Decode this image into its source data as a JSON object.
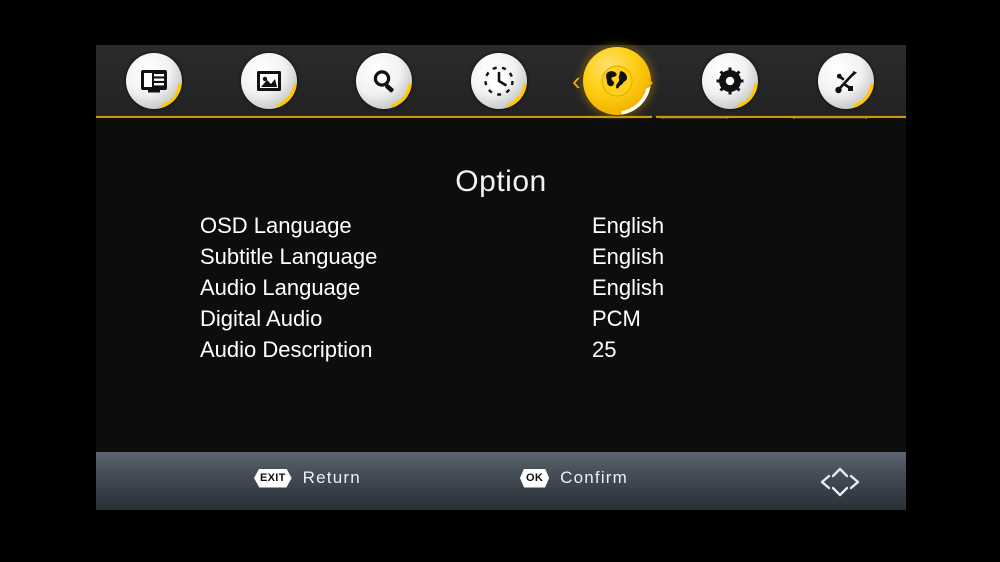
{
  "nav": {
    "items": [
      {
        "name": "channel-list",
        "icon": "tv-list-icon",
        "selected": false
      },
      {
        "name": "picture",
        "icon": "image-icon",
        "selected": false
      },
      {
        "name": "search",
        "icon": "magnifier-icon",
        "selected": false
      },
      {
        "name": "time",
        "icon": "clock-icon",
        "selected": false
      },
      {
        "name": "option",
        "icon": "globe-icon",
        "selected": true
      },
      {
        "name": "system",
        "icon": "gear-icon",
        "selected": false
      },
      {
        "name": "usb",
        "icon": "usb-icon",
        "selected": false
      }
    ],
    "prev_arrow": "‹",
    "next_arrow": "›"
  },
  "main": {
    "title": "Option",
    "rows": [
      {
        "label": "OSD Language",
        "value": "English"
      },
      {
        "label": "Subtitle Language",
        "value": "English"
      },
      {
        "label": "Audio Language",
        "value": "English"
      },
      {
        "label": "Digital Audio",
        "value": "PCM"
      },
      {
        "label": "Audio Description",
        "value": "25"
      }
    ]
  },
  "footer": {
    "hints": [
      {
        "key": "EXIT",
        "label": "Return"
      },
      {
        "key": "OK",
        "label": "Confirm"
      }
    ],
    "dpad": "dpad-icon"
  },
  "colors": {
    "accent_gold": "#e8b10a",
    "highlight_yellow": "#ffd11a",
    "panel_dark": "#262626",
    "content_bg": "#0d0d0d",
    "footer_top": "#5c6570",
    "footer_bottom": "#2b3038",
    "text_primary": "#ffffff"
  }
}
